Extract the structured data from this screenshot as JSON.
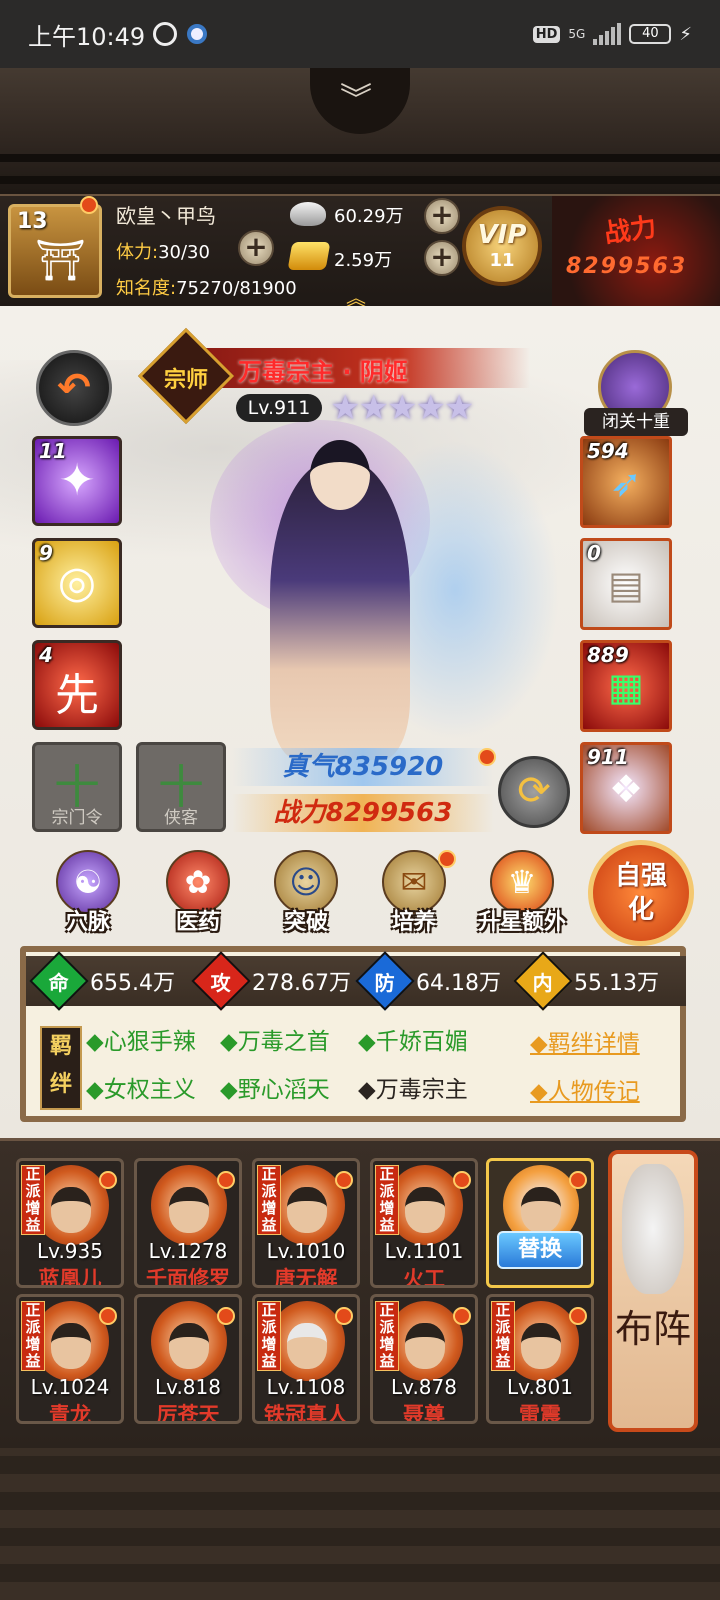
{
  "status_bar": {
    "time": "上午10:49",
    "hd": "HD",
    "network": "5G",
    "battery": "40"
  },
  "header": {
    "nav_icon": "chevron-down-icon"
  },
  "player": {
    "level": "13",
    "name": "欧皇丶甲鸟",
    "stamina_label": "体力:",
    "stamina_value": "30/30",
    "fame_label": "知名度:",
    "fame_value": "75270/81900",
    "silver": "60.29万",
    "gold": "2.59万",
    "vip_label": "VIP",
    "vip_level": "11",
    "power_label": "战力",
    "power_value": "8299563"
  },
  "character": {
    "rank": "宗师",
    "title": "万毒宗主 · 阴姬",
    "level": "Lv.911",
    "stars": 5,
    "stars_text": "★★★★★",
    "seclusion": "闭关十重",
    "zhenqi": "真气835920",
    "zhanli": "战力8299563"
  },
  "skills": [
    {
      "count": "11",
      "icon": "shuriken-icon",
      "glyph": "✦"
    },
    {
      "count": "9",
      "icon": "swirl-icon",
      "glyph": "◎"
    },
    {
      "count": "4",
      "icon": "first-strike-icon",
      "glyph": "先"
    }
  ],
  "equipment": [
    {
      "count": "594",
      "icon": "blade-icon",
      "glyph": "➶"
    },
    {
      "count": "0",
      "icon": "robe-icon",
      "glyph": "▤"
    },
    {
      "count": "889",
      "icon": "manual-icon",
      "glyph": "▦"
    },
    {
      "count": "911",
      "icon": "spirit-deer-icon",
      "glyph": "❖"
    }
  ],
  "empty_slots": [
    "宗门令",
    "侠客"
  ],
  "slot_plus": "十",
  "actions": [
    {
      "label": "穴脉",
      "glyph": "☯"
    },
    {
      "label": "医药",
      "glyph": "✿"
    },
    {
      "label": "突破",
      "glyph": "☺"
    },
    {
      "label": "培养",
      "glyph": "✉"
    },
    {
      "label": "升星额外",
      "glyph": "♛"
    }
  ],
  "auto_strengthen": "自强化",
  "stats": [
    {
      "icon": "命",
      "value": "655.4万",
      "color": "#1aa83a"
    },
    {
      "icon": "攻",
      "value": "278.67万",
      "color": "#d8261a"
    },
    {
      "icon": "防",
      "value": "64.18万",
      "color": "#1a6ad8"
    },
    {
      "icon": "内",
      "value": "55.13万",
      "color": "#e8a818"
    }
  ],
  "bonds": {
    "tag": "羁绊",
    "items": [
      {
        "label": "◆心狠手辣",
        "active": true
      },
      {
        "label": "◆万毒之首",
        "active": true
      },
      {
        "label": "◆千娇百媚",
        "active": true
      },
      {
        "label": "◆女权主义",
        "active": true
      },
      {
        "label": "◆野心滔天",
        "active": true
      },
      {
        "label": "◆万毒宗主",
        "active": false
      }
    ],
    "details_link": "◆羁绊详情",
    "biography_link": "◆人物传记"
  },
  "roster": {
    "tag": "正派增益",
    "swap_label": "替换",
    "formation_label": "布阵",
    "heroes": [
      {
        "level": "Lv.935",
        "name": "蓝凰儿"
      },
      {
        "level": "Lv.1278",
        "name": "千面修罗"
      },
      {
        "level": "Lv.1010",
        "name": "唐无解"
      },
      {
        "level": "Lv.1101",
        "name": "火工"
      },
      {
        "level": "",
        "name": ""
      },
      {
        "level": "Lv.1024",
        "name": "青龙"
      },
      {
        "level": "Lv.818",
        "name": "厉苍天"
      },
      {
        "level": "Lv.1108",
        "name": "铁冠真人"
      },
      {
        "level": "Lv.878",
        "name": "聂尊"
      },
      {
        "level": "Lv.801",
        "name": "雷震"
      }
    ]
  }
}
